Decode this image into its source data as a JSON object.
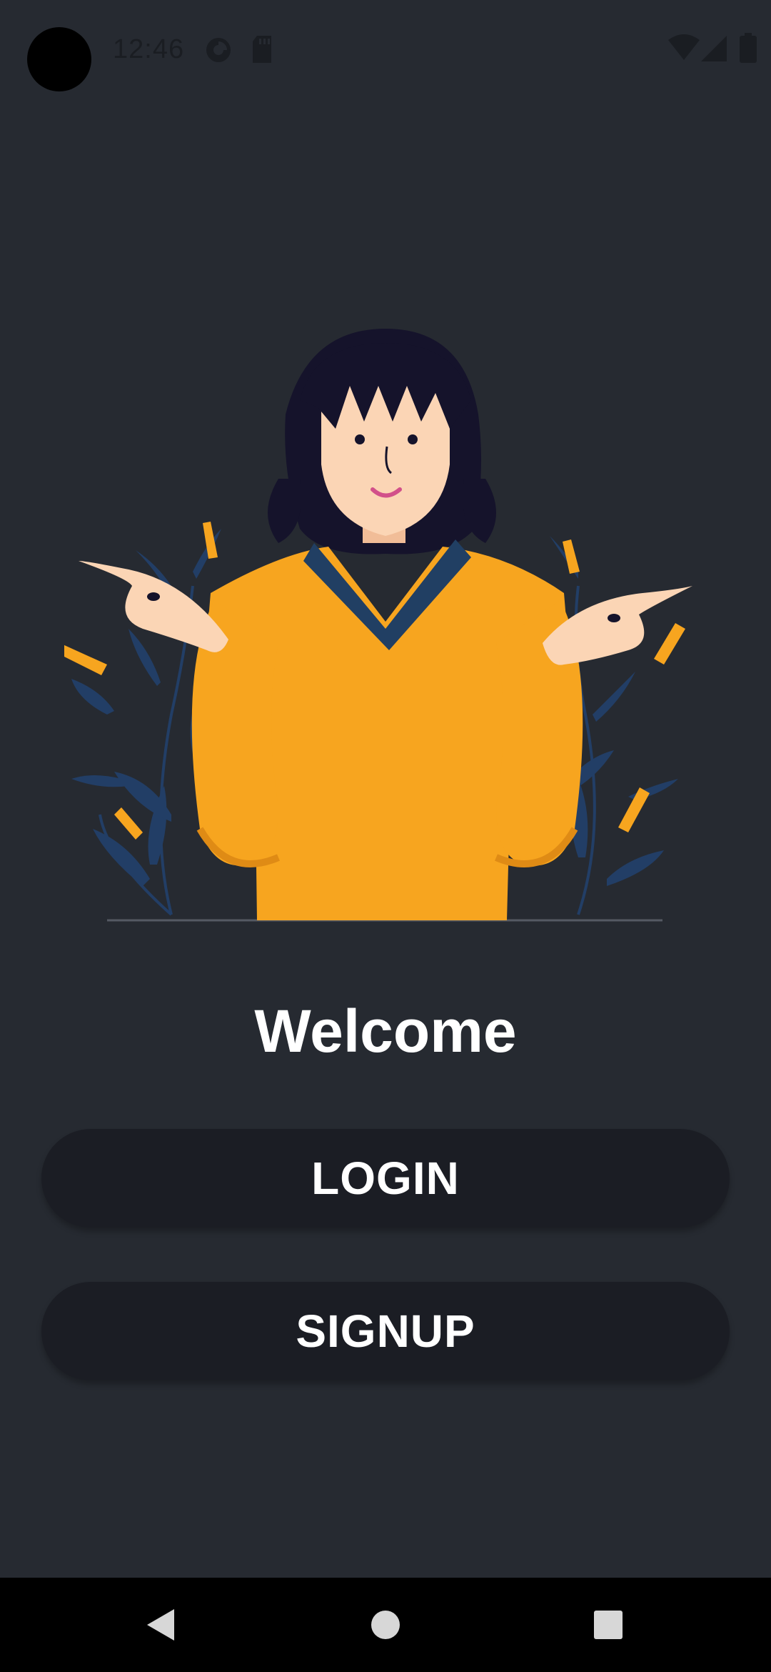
{
  "status_bar": {
    "time": "12:46",
    "icons": [
      "camera-cutout",
      "data-saver-icon",
      "sd-card-icon",
      "wifi-icon",
      "cell-signal-icon",
      "battery-icon"
    ]
  },
  "illustration": {
    "name": "woman-in-yellow-sweater-illustration",
    "colors": {
      "sweater": "#f7a51f",
      "collar": "#213f63",
      "hair": "#15132b",
      "skin": "#fbd5b5",
      "leaves": "#223e66"
    }
  },
  "main": {
    "welcome": "Welcome",
    "login_label": "LOGIN",
    "signup_label": "SIGNUP"
  },
  "nav_bar": {
    "icons": [
      "back-icon",
      "home-icon",
      "recents-icon"
    ]
  },
  "colors": {
    "background": "#262a31",
    "button": "#1b1d24",
    "text": "#ffffff"
  }
}
